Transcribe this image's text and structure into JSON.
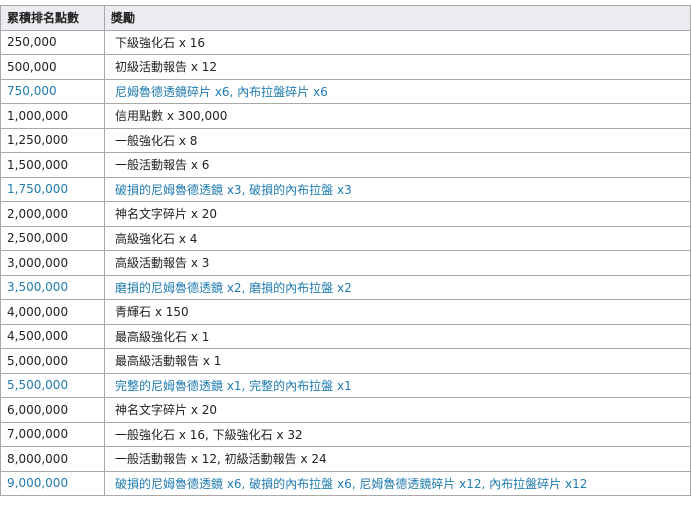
{
  "table": {
    "headers": [
      "累積排名點數",
      "獎勵"
    ],
    "rows": [
      {
        "points": "250,000",
        "reward": "下級強化石 x 16",
        "highlight": false
      },
      {
        "points": "500,000",
        "reward": "初級活動報告 x 12",
        "highlight": false
      },
      {
        "points": "750,000",
        "reward": "尼姆魯德透鏡碎片 x6, 內布拉盤碎片 x6",
        "highlight": true
      },
      {
        "points": "1,000,000",
        "reward": "信用點數 x 300,000",
        "highlight": false
      },
      {
        "points": "1,250,000",
        "reward": "一般強化石 x 8",
        "highlight": false
      },
      {
        "points": "1,500,000",
        "reward": "一般活動報告 x 6",
        "highlight": false
      },
      {
        "points": "1,750,000",
        "reward": "破損的尼姆魯德透鏡 x3, 破損的內布拉盤 x3",
        "highlight": true
      },
      {
        "points": "2,000,000",
        "reward": "神名文字碎片 x 20",
        "highlight": false
      },
      {
        "points": "2,500,000",
        "reward": "高級強化石 x 4",
        "highlight": false
      },
      {
        "points": "3,000,000",
        "reward": "高級活動報告 x 3",
        "highlight": false
      },
      {
        "points": "3,500,000",
        "reward": "磨損的尼姆魯德透鏡 x2, 磨損的內布拉盤 x2",
        "highlight": true
      },
      {
        "points": "4,000,000",
        "reward": "青輝石 x 150",
        "highlight": false
      },
      {
        "points": "4,500,000",
        "reward": "最高級強化石 x 1",
        "highlight": false
      },
      {
        "points": "5,000,000",
        "reward": "最高級活動報告 x 1",
        "highlight": false
      },
      {
        "points": "5,500,000",
        "reward": "完整的尼姆魯德透鏡 x1, 完整的內布拉盤 x1",
        "highlight": true
      },
      {
        "points": "6,000,000",
        "reward": "神名文字碎片 x 20",
        "highlight": false
      },
      {
        "points": "7,000,000",
        "reward": "一般強化石 x 16, 下級強化石 x 32",
        "highlight": false
      },
      {
        "points": "8,000,000",
        "reward": "一般活動報告 x 12, 初級活動報告 x 24",
        "highlight": false
      },
      {
        "points": "9,000,000",
        "reward": "破損的尼姆魯德透鏡 x6, 破損的內布拉盤 x6, 尼姆魯德透鏡碎片 x12, 內布拉盤碎片 x12",
        "highlight": true
      }
    ]
  },
  "colors": {
    "header_bg": "#eaecf0",
    "border": "#a8a8a8",
    "text": "#222222",
    "highlight_text": "#1f7bb0"
  }
}
